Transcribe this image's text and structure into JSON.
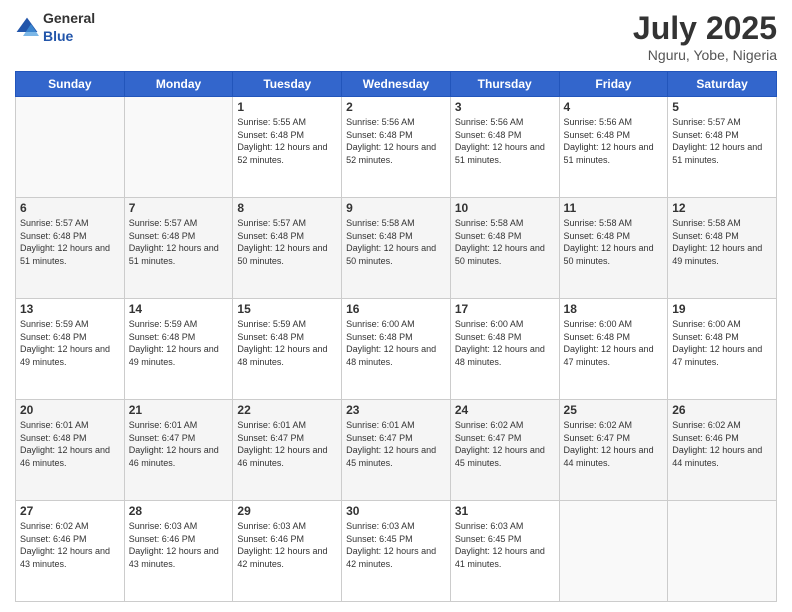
{
  "header": {
    "logo_general": "General",
    "logo_blue": "Blue",
    "title": "July 2025",
    "subtitle": "Nguru, Yobe, Nigeria"
  },
  "calendar": {
    "days_of_week": [
      "Sunday",
      "Monday",
      "Tuesday",
      "Wednesday",
      "Thursday",
      "Friday",
      "Saturday"
    ],
    "weeks": [
      [
        {
          "day": "",
          "sunrise": "",
          "sunset": "",
          "daylight": ""
        },
        {
          "day": "",
          "sunrise": "",
          "sunset": "",
          "daylight": ""
        },
        {
          "day": "1",
          "sunrise": "Sunrise: 5:55 AM",
          "sunset": "Sunset: 6:48 PM",
          "daylight": "Daylight: 12 hours and 52 minutes."
        },
        {
          "day": "2",
          "sunrise": "Sunrise: 5:56 AM",
          "sunset": "Sunset: 6:48 PM",
          "daylight": "Daylight: 12 hours and 52 minutes."
        },
        {
          "day": "3",
          "sunrise": "Sunrise: 5:56 AM",
          "sunset": "Sunset: 6:48 PM",
          "daylight": "Daylight: 12 hours and 51 minutes."
        },
        {
          "day": "4",
          "sunrise": "Sunrise: 5:56 AM",
          "sunset": "Sunset: 6:48 PM",
          "daylight": "Daylight: 12 hours and 51 minutes."
        },
        {
          "day": "5",
          "sunrise": "Sunrise: 5:57 AM",
          "sunset": "Sunset: 6:48 PM",
          "daylight": "Daylight: 12 hours and 51 minutes."
        }
      ],
      [
        {
          "day": "6",
          "sunrise": "Sunrise: 5:57 AM",
          "sunset": "Sunset: 6:48 PM",
          "daylight": "Daylight: 12 hours and 51 minutes."
        },
        {
          "day": "7",
          "sunrise": "Sunrise: 5:57 AM",
          "sunset": "Sunset: 6:48 PM",
          "daylight": "Daylight: 12 hours and 51 minutes."
        },
        {
          "day": "8",
          "sunrise": "Sunrise: 5:57 AM",
          "sunset": "Sunset: 6:48 PM",
          "daylight": "Daylight: 12 hours and 50 minutes."
        },
        {
          "day": "9",
          "sunrise": "Sunrise: 5:58 AM",
          "sunset": "Sunset: 6:48 PM",
          "daylight": "Daylight: 12 hours and 50 minutes."
        },
        {
          "day": "10",
          "sunrise": "Sunrise: 5:58 AM",
          "sunset": "Sunset: 6:48 PM",
          "daylight": "Daylight: 12 hours and 50 minutes."
        },
        {
          "day": "11",
          "sunrise": "Sunrise: 5:58 AM",
          "sunset": "Sunset: 6:48 PM",
          "daylight": "Daylight: 12 hours and 50 minutes."
        },
        {
          "day": "12",
          "sunrise": "Sunrise: 5:58 AM",
          "sunset": "Sunset: 6:48 PM",
          "daylight": "Daylight: 12 hours and 49 minutes."
        }
      ],
      [
        {
          "day": "13",
          "sunrise": "Sunrise: 5:59 AM",
          "sunset": "Sunset: 6:48 PM",
          "daylight": "Daylight: 12 hours and 49 minutes."
        },
        {
          "day": "14",
          "sunrise": "Sunrise: 5:59 AM",
          "sunset": "Sunset: 6:48 PM",
          "daylight": "Daylight: 12 hours and 49 minutes."
        },
        {
          "day": "15",
          "sunrise": "Sunrise: 5:59 AM",
          "sunset": "Sunset: 6:48 PM",
          "daylight": "Daylight: 12 hours and 48 minutes."
        },
        {
          "day": "16",
          "sunrise": "Sunrise: 6:00 AM",
          "sunset": "Sunset: 6:48 PM",
          "daylight": "Daylight: 12 hours and 48 minutes."
        },
        {
          "day": "17",
          "sunrise": "Sunrise: 6:00 AM",
          "sunset": "Sunset: 6:48 PM",
          "daylight": "Daylight: 12 hours and 48 minutes."
        },
        {
          "day": "18",
          "sunrise": "Sunrise: 6:00 AM",
          "sunset": "Sunset: 6:48 PM",
          "daylight": "Daylight: 12 hours and 47 minutes."
        },
        {
          "day": "19",
          "sunrise": "Sunrise: 6:00 AM",
          "sunset": "Sunset: 6:48 PM",
          "daylight": "Daylight: 12 hours and 47 minutes."
        }
      ],
      [
        {
          "day": "20",
          "sunrise": "Sunrise: 6:01 AM",
          "sunset": "Sunset: 6:48 PM",
          "daylight": "Daylight: 12 hours and 46 minutes."
        },
        {
          "day": "21",
          "sunrise": "Sunrise: 6:01 AM",
          "sunset": "Sunset: 6:47 PM",
          "daylight": "Daylight: 12 hours and 46 minutes."
        },
        {
          "day": "22",
          "sunrise": "Sunrise: 6:01 AM",
          "sunset": "Sunset: 6:47 PM",
          "daylight": "Daylight: 12 hours and 46 minutes."
        },
        {
          "day": "23",
          "sunrise": "Sunrise: 6:01 AM",
          "sunset": "Sunset: 6:47 PM",
          "daylight": "Daylight: 12 hours and 45 minutes."
        },
        {
          "day": "24",
          "sunrise": "Sunrise: 6:02 AM",
          "sunset": "Sunset: 6:47 PM",
          "daylight": "Daylight: 12 hours and 45 minutes."
        },
        {
          "day": "25",
          "sunrise": "Sunrise: 6:02 AM",
          "sunset": "Sunset: 6:47 PM",
          "daylight": "Daylight: 12 hours and 44 minutes."
        },
        {
          "day": "26",
          "sunrise": "Sunrise: 6:02 AM",
          "sunset": "Sunset: 6:46 PM",
          "daylight": "Daylight: 12 hours and 44 minutes."
        }
      ],
      [
        {
          "day": "27",
          "sunrise": "Sunrise: 6:02 AM",
          "sunset": "Sunset: 6:46 PM",
          "daylight": "Daylight: 12 hours and 43 minutes."
        },
        {
          "day": "28",
          "sunrise": "Sunrise: 6:03 AM",
          "sunset": "Sunset: 6:46 PM",
          "daylight": "Daylight: 12 hours and 43 minutes."
        },
        {
          "day": "29",
          "sunrise": "Sunrise: 6:03 AM",
          "sunset": "Sunset: 6:46 PM",
          "daylight": "Daylight: 12 hours and 42 minutes."
        },
        {
          "day": "30",
          "sunrise": "Sunrise: 6:03 AM",
          "sunset": "Sunset: 6:45 PM",
          "daylight": "Daylight: 12 hours and 42 minutes."
        },
        {
          "day": "31",
          "sunrise": "Sunrise: 6:03 AM",
          "sunset": "Sunset: 6:45 PM",
          "daylight": "Daylight: 12 hours and 41 minutes."
        },
        {
          "day": "",
          "sunrise": "",
          "sunset": "",
          "daylight": ""
        },
        {
          "day": "",
          "sunrise": "",
          "sunset": "",
          "daylight": ""
        }
      ]
    ]
  }
}
